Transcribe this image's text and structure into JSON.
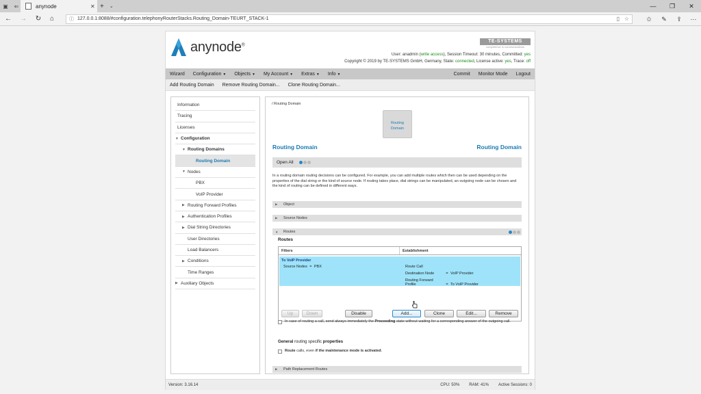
{
  "browser": {
    "tab_title": "anynode",
    "url": "127.0.0.1:8088/#configuration.telephonyRouterStacks.Routing_Domain-TEURT_STACK-1"
  },
  "header": {
    "logo_text": "anynode",
    "logo_mark": "®",
    "company_badge": "TE-SYSTEMS",
    "company_sub": "competence in communications",
    "session_line1_a": "User: anadmin (",
    "session_line1_b": "write access",
    "session_line1_c": "), Session Timeout: 30 minutes, Committed: ",
    "session_line1_d": "yes",
    "session_line2_a": "Copyright © 2019 by TE-SYSTEMS GmbH, Germany, State: ",
    "session_line2_b": "connected",
    "session_line2_c": ", License active: ",
    "session_line2_d": "yes",
    "session_line2_e": ", Trace: ",
    "session_line2_f": "off"
  },
  "menu": {
    "wizard": "Wizard",
    "configuration": "Configuration",
    "objects": "Objects",
    "my_account": "My Account",
    "extras": "Extras",
    "info": "Info",
    "commit": "Commit",
    "monitor_mode": "Monitor Mode",
    "logout": "Logout"
  },
  "submenu": {
    "add": "Add Routing Domain",
    "remove": "Remove Routing Domain...",
    "clone": "Clone Routing Domain..."
  },
  "sidebar": {
    "items": [
      {
        "label": "Information"
      },
      {
        "label": "Tracing"
      },
      {
        "label": "Licenses"
      },
      {
        "label": "Configuration"
      },
      {
        "label": "Routing Domains"
      },
      {
        "label": "Routing Domain"
      },
      {
        "label": "Nodes"
      },
      {
        "label": "PBX"
      },
      {
        "label": "VoIP Provider"
      },
      {
        "label": "Routing Forward Profiles"
      },
      {
        "label": "Authentication Profiles"
      },
      {
        "label": "Dial String Directories"
      },
      {
        "label": "User Directories"
      },
      {
        "label": "Load Balancers"
      },
      {
        "label": "Conditions"
      },
      {
        "label": "Time Ranges"
      },
      {
        "label": "Auxiliary Objects"
      }
    ]
  },
  "main": {
    "breadcrumb": "/ Routing Domain",
    "box_label_1": "Routing",
    "box_label_2": "Domain",
    "heading_left": "Routing Domain",
    "heading_right": "Routing Domain",
    "open_all": "Open All",
    "description": "In a routing domain routing decisions can be configured. For example, you can add multiple routes which then can be used depending on the properties of the dial string or the kind of source node. If routing takes place, dial strings can be manipulated, an outgoing node can be chosen and the kind of routing can be defined in different ways.",
    "sections": {
      "object": "Object",
      "source_nodes": "Source Nodes",
      "routes": "Routes",
      "path_replacement": "Path Replacement Routes"
    },
    "routes_label": "Routes",
    "table": {
      "col_filters": "Filters",
      "col_establishment": "Establishment",
      "row": {
        "name": "To VoIP Provider",
        "filter_key": "Source Nodes",
        "filter_eq": "=",
        "filter_val": "PBX",
        "est1": "Route Call",
        "est2_key": "Destination Node",
        "est2_eq": "=",
        "est2_val": "VoIP Provider",
        "est3_key": "Routing Forward Profile",
        "est3_eq": "=",
        "est3_val": "To VoIP Provider"
      }
    },
    "buttons": {
      "up": "Up",
      "down": "Down",
      "disable": "Disable",
      "add": "Add...",
      "clone": "Clone",
      "edit": "Edit...",
      "remove": "Remove"
    },
    "proceeding_a": "In case of routing a call, send always immediately the ",
    "proceeding_b": "Proceeding",
    "proceeding_c": " state without waiting for a corresponding answer of the outgoing call.",
    "general_a": "General",
    "general_b": " routing specific ",
    "general_c": "properties",
    "maint_a": "Route",
    "maint_b": " calls, even ",
    "maint_c": "if the maintenance mode is activated",
    "maint_d": "."
  },
  "footer": {
    "version": "Version: 3.16.14",
    "cpu": "CPU: 50%",
    "ram": "RAM: 41%",
    "sessions": "Active Sessions: 0"
  },
  "colors": {
    "accent": "#1a7ab0",
    "selected_row": "#9ee3f9",
    "ok_green": "#1a8a1a"
  }
}
